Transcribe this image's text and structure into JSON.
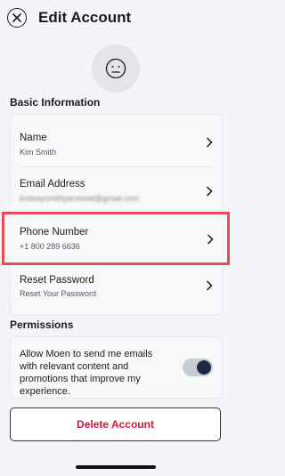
{
  "header": {
    "title": "Edit Account"
  },
  "basic_info": {
    "section_title": "Basic Information",
    "name_label": "Name",
    "name_value": "Kim Smith",
    "email_label": "Email Address",
    "email_value": "lindseysmithpersonal@gmail.com",
    "phone_label": "Phone Number",
    "phone_value": "+1 800 289 6636",
    "password_label": "Reset Password",
    "password_value": "Reset Your Password"
  },
  "permissions": {
    "section_title": "Permissions",
    "email_opt_in_text": "Allow Moen to send me emails with relevant content and promotions that improve my experience.",
    "email_opt_in_on": true
  },
  "delete_button_label": "Delete Account",
  "colors": {
    "highlight": "#ea4b55",
    "delete_text": "#d3143b",
    "toggle_knob": "#1c2a46"
  }
}
